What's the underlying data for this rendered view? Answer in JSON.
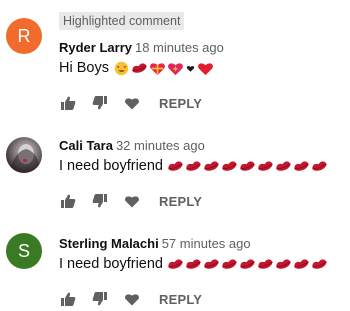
{
  "colors": {
    "avatar_r": "#f06b2c",
    "avatar_s": "#3a7a22",
    "secondary_text": "#606060",
    "badge_bg": "#e9e9e9",
    "lips": "#c4172f"
  },
  "comments": [
    {
      "avatar_letter": "R",
      "badge": "Highlighted comment",
      "author": "Ryder Larry",
      "time": "18 minutes ago",
      "text": "Hi Boys",
      "emojis": [
        "heart-eyes-face-emoji",
        "lips-emoji",
        "gift-heart-emoji",
        "sparkling-heart-emoji",
        "black-heart-suit-emoji",
        "red-heart-emoji"
      ],
      "reply_label": "REPLY"
    },
    {
      "avatar_letter": "",
      "author": "Cali Tara",
      "time": "32 minutes ago",
      "text": "I need boyfriend",
      "emojis": [
        "lips-emoji",
        "lips-emoji",
        "lips-emoji",
        "lips-emoji",
        "lips-emoji",
        "lips-emoji",
        "lips-emoji",
        "lips-emoji",
        "lips-emoji"
      ],
      "reply_label": "REPLY"
    },
    {
      "avatar_letter": "S",
      "author": "Sterling Malachi",
      "time": "57 minutes ago",
      "text": "I need boyfriend",
      "emojis": [
        "lips-emoji",
        "lips-emoji",
        "lips-emoji",
        "lips-emoji",
        "lips-emoji",
        "lips-emoji",
        "lips-emoji",
        "lips-emoji",
        "lips-emoji"
      ],
      "reply_label": "REPLY"
    }
  ],
  "icons": {
    "like": "thumbs-up-icon",
    "dislike": "thumbs-down-icon",
    "heart": "heart-icon"
  }
}
